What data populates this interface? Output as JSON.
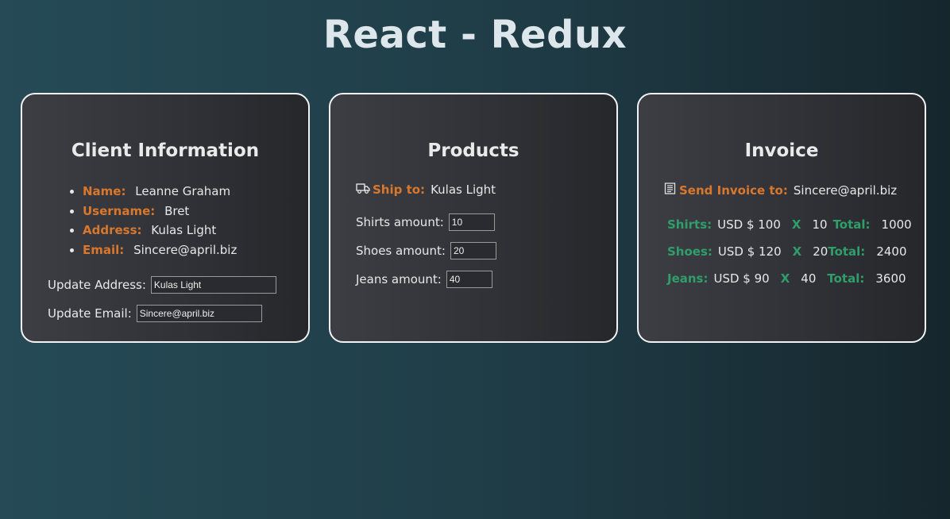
{
  "app": {
    "title": "React - Redux"
  },
  "client": {
    "title": "Client Information",
    "fields": [
      {
        "label": "Name:",
        "value": "Leanne Graham"
      },
      {
        "label": "Username:",
        "value": "Bret"
      },
      {
        "label": "Address:",
        "value": "Kulas Light"
      },
      {
        "label": "Email:",
        "value": "Sincere@april.biz"
      }
    ],
    "update_address": {
      "label": "Update Address:",
      "value": "Kulas Light"
    },
    "update_email": {
      "label": "Update Email:",
      "value": "Sincere@april.biz"
    }
  },
  "products": {
    "title": "Products",
    "ship_to": {
      "icon": "truck-icon",
      "label": "Ship to:",
      "value": "Kulas Light"
    },
    "amounts": [
      {
        "label": "Shirts amount:",
        "value": "10"
      },
      {
        "label": "Shoes amount:",
        "value": "20"
      },
      {
        "label": "Jeans amount:",
        "value": "40"
      }
    ]
  },
  "invoice": {
    "title": "Invoice",
    "send": {
      "icon": "invoice-icon",
      "label": "Send Invoice to:",
      "value": "Sincere@april.biz"
    },
    "lines": [
      {
        "item": "Shirts:",
        "price": "USD $ 100",
        "x": "X",
        "qty": "10",
        "total_label": "Total:",
        "total": "1000"
      },
      {
        "item": "Shoes:",
        "price": "USD $ 120",
        "x": "X",
        "qty": "20",
        "total_label": "Total:",
        "total": "2400"
      },
      {
        "item": "Jeans:",
        "price": "USD $ 90",
        "x": "X",
        "qty": "40",
        "total_label": "Total:",
        "total": "3600"
      }
    ]
  },
  "colors": {
    "label_orange": "#d9782d",
    "label_green": "#2f9e6a",
    "card_border": "#f2f2f2"
  }
}
